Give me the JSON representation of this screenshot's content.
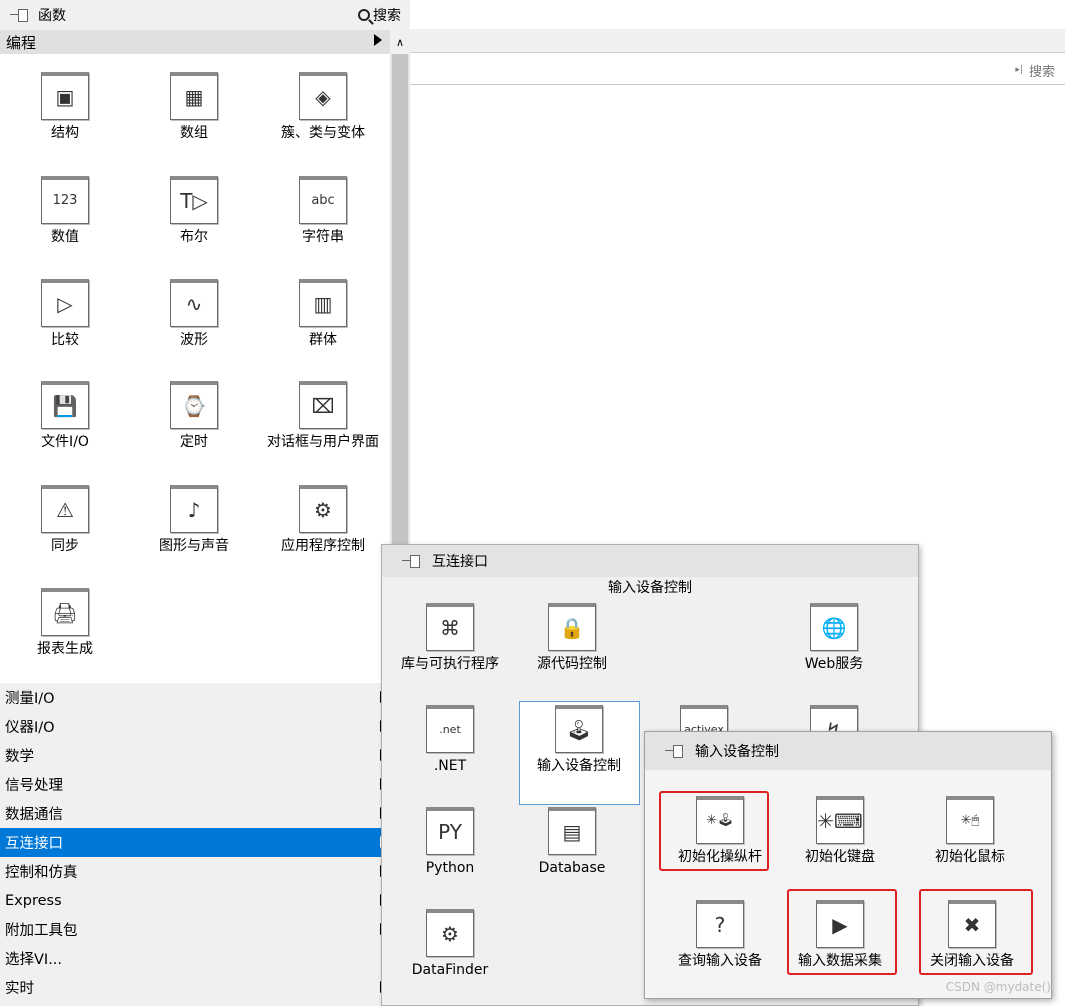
{
  "background": {
    "search_label": "搜索"
  },
  "palette": {
    "title": "函数",
    "search_label": "搜索",
    "current_category": "编程",
    "items": [
      {
        "label": "结构",
        "icon": "structure-icon",
        "glyph": "▣"
      },
      {
        "label": "数组",
        "icon": "array-icon",
        "glyph": "▦"
      },
      {
        "label": "簇、类与变体",
        "icon": "cluster-class-variant-icon",
        "glyph": "◈"
      },
      {
        "label": "数值",
        "icon": "numeric-icon",
        "glyph": "123"
      },
      {
        "label": "布尔",
        "icon": "boolean-icon",
        "glyph": "T▷"
      },
      {
        "label": "字符串",
        "icon": "string-icon",
        "glyph": "abc"
      },
      {
        "label": "比较",
        "icon": "comparison-icon",
        "glyph": "▷"
      },
      {
        "label": "波形",
        "icon": "waveform-icon",
        "glyph": "∿"
      },
      {
        "label": "群体",
        "icon": "synchronization-group-icon",
        "glyph": "▥"
      },
      {
        "label": "文件I/O",
        "icon": "file-io-icon",
        "glyph": "💾"
      },
      {
        "label": "定时",
        "icon": "timing-watch-icon",
        "glyph": "⌚"
      },
      {
        "label": "对话框与用户界面",
        "icon": "dialog-ui-icon",
        "glyph": "⌧"
      },
      {
        "label": "同步",
        "icon": "synchronization-icon",
        "glyph": "⚠"
      },
      {
        "label": "图形与声音",
        "icon": "graphics-sound-icon",
        "glyph": "♪"
      },
      {
        "label": "应用程序控制",
        "icon": "application-control-icon",
        "glyph": "⚙"
      },
      {
        "label": "报表生成",
        "icon": "report-generation-icon",
        "glyph": "🖨"
      }
    ],
    "categories": [
      {
        "label": "测量I/O",
        "selected": false
      },
      {
        "label": "仪器I/O",
        "selected": false
      },
      {
        "label": "数学",
        "selected": false
      },
      {
        "label": "信号处理",
        "selected": false
      },
      {
        "label": "数据通信",
        "selected": false
      },
      {
        "label": "互连接口",
        "selected": true
      },
      {
        "label": "控制和仿真",
        "selected": false
      },
      {
        "label": "Express",
        "selected": false
      },
      {
        "label": "附加工具包",
        "selected": false
      },
      {
        "label": "选择VI...",
        "selected": false
      },
      {
        "label": "实时",
        "selected": false
      }
    ]
  },
  "interconnect": {
    "title": "互连接口",
    "subtitle": "输入设备控制",
    "items": [
      {
        "label": "库与可执行程序",
        "icon": "libraries-executables-icon",
        "glyph": "⌘"
      },
      {
        "label": "源代码控制",
        "icon": "source-control-icon",
        "glyph": "🔒"
      },
      {
        "label": "Web服务",
        "icon": "web-services-icon",
        "glyph": "🌐"
      },
      {
        "label": ".NET",
        "icon": "dotnet-icon",
        "glyph": ".net"
      },
      {
        "label": "输入设备控制",
        "icon": "input-device-control-icon",
        "glyph": "🕹"
      },
      {
        "label": "",
        "icon": "activex-icon",
        "glyph": "activex"
      },
      {
        "label": "",
        "icon": "partially-hidden-icon",
        "glyph": "↯"
      },
      {
        "label": "Python",
        "icon": "python-icon",
        "glyph": "PY"
      },
      {
        "label": "Database",
        "icon": "database-icon",
        "glyph": "▤"
      },
      {
        "label": "DataFinder",
        "icon": "datafinder-gear-icon",
        "glyph": "⚙"
      }
    ]
  },
  "input_device": {
    "title": "输入设备控制",
    "items": [
      {
        "label": "初始化操纵杆",
        "icon": "init-joystick-icon",
        "glyph": "✳🕹",
        "highlighted": true
      },
      {
        "label": "初始化键盘",
        "icon": "init-keyboard-icon",
        "glyph": "✳⌨",
        "highlighted": false
      },
      {
        "label": "初始化鼠标",
        "icon": "init-mouse-icon",
        "glyph": "✳🖱",
        "highlighted": false
      },
      {
        "label": "查询输入设备",
        "icon": "query-input-device-icon",
        "glyph": "?",
        "highlighted": false
      },
      {
        "label": "输入数据采集",
        "icon": "acquire-input-data-icon",
        "glyph": "▶",
        "highlighted": true
      },
      {
        "label": "关闭输入设备",
        "icon": "close-input-device-icon",
        "glyph": "✖",
        "highlighted": true
      }
    ]
  },
  "watermark": "CSDN @mydate()",
  "colors": {
    "selection": "#0078d7",
    "highlight_box": "#e02020"
  }
}
